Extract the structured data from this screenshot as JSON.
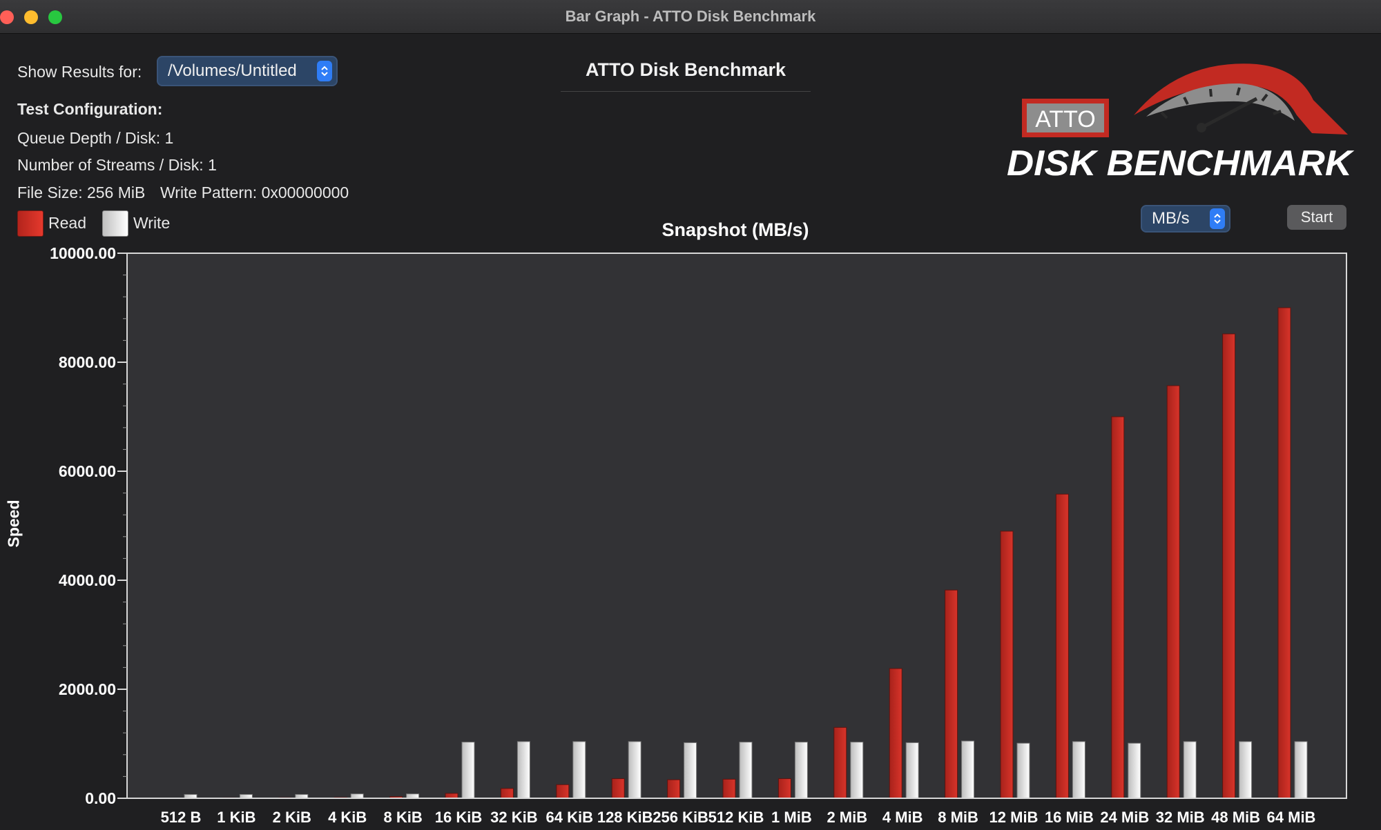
{
  "window": {
    "title": "Bar Graph - ATTO Disk Benchmark"
  },
  "controls": {
    "show_results_label": "Show Results for:",
    "volume_value": "/Volumes/Untitled",
    "unit_value": "MB/s",
    "start_label": "Start"
  },
  "app_title": "ATTO Disk Benchmark",
  "config": {
    "heading": "Test Configuration:",
    "queue_depth": "Queue Depth / Disk: 1",
    "streams": "Number of Streams / Disk: 1",
    "file_size": "File Size: 256 MiB",
    "write_pattern": "Write Pattern: 0x00000000"
  },
  "logo": {
    "badge_text": "ATTO",
    "wordmark": "DISK BENCHMARK"
  },
  "legend": {
    "read_label": "Read",
    "write_label": "Write"
  },
  "colors": {
    "read": "#d8342a",
    "write": "#eeeeee",
    "accent": "#2f7df6",
    "plot_bg": "#323235"
  },
  "chart_data": {
    "type": "bar",
    "title": "Snapshot (MB/s)",
    "ylabel": "Speed",
    "xlabel": "",
    "ylim": [
      0,
      10000
    ],
    "yticks": [
      "0.00",
      "2000.00",
      "4000.00",
      "6000.00",
      "8000.00",
      "10000.00"
    ],
    "categories": [
      "512 B",
      "1 KiB",
      "2 KiB",
      "4 KiB",
      "8 KiB",
      "16 KiB",
      "32 KiB",
      "64 KiB",
      "128 KiB",
      "256 KiB",
      "512 KiB",
      "1 MiB",
      "2 MiB",
      "4 MiB",
      "8 MiB",
      "12 MiB",
      "16 MiB",
      "24 MiB",
      "32 MiB",
      "48 MiB",
      "64 MiB"
    ],
    "series": [
      {
        "name": "Read",
        "values": [
          5,
          8,
          10,
          15,
          30,
          90,
          180,
          250,
          360,
          340,
          350,
          360,
          1300,
          2380,
          3820,
          4900,
          5580,
          7000,
          7570,
          8520,
          9000
        ]
      },
      {
        "name": "Write",
        "values": [
          70,
          70,
          70,
          80,
          80,
          1030,
          1040,
          1040,
          1040,
          1020,
          1030,
          1030,
          1030,
          1020,
          1050,
          1010,
          1040,
          1010,
          1040,
          1040,
          1040
        ]
      }
    ],
    "grid": false,
    "legend_position": "top-left"
  }
}
